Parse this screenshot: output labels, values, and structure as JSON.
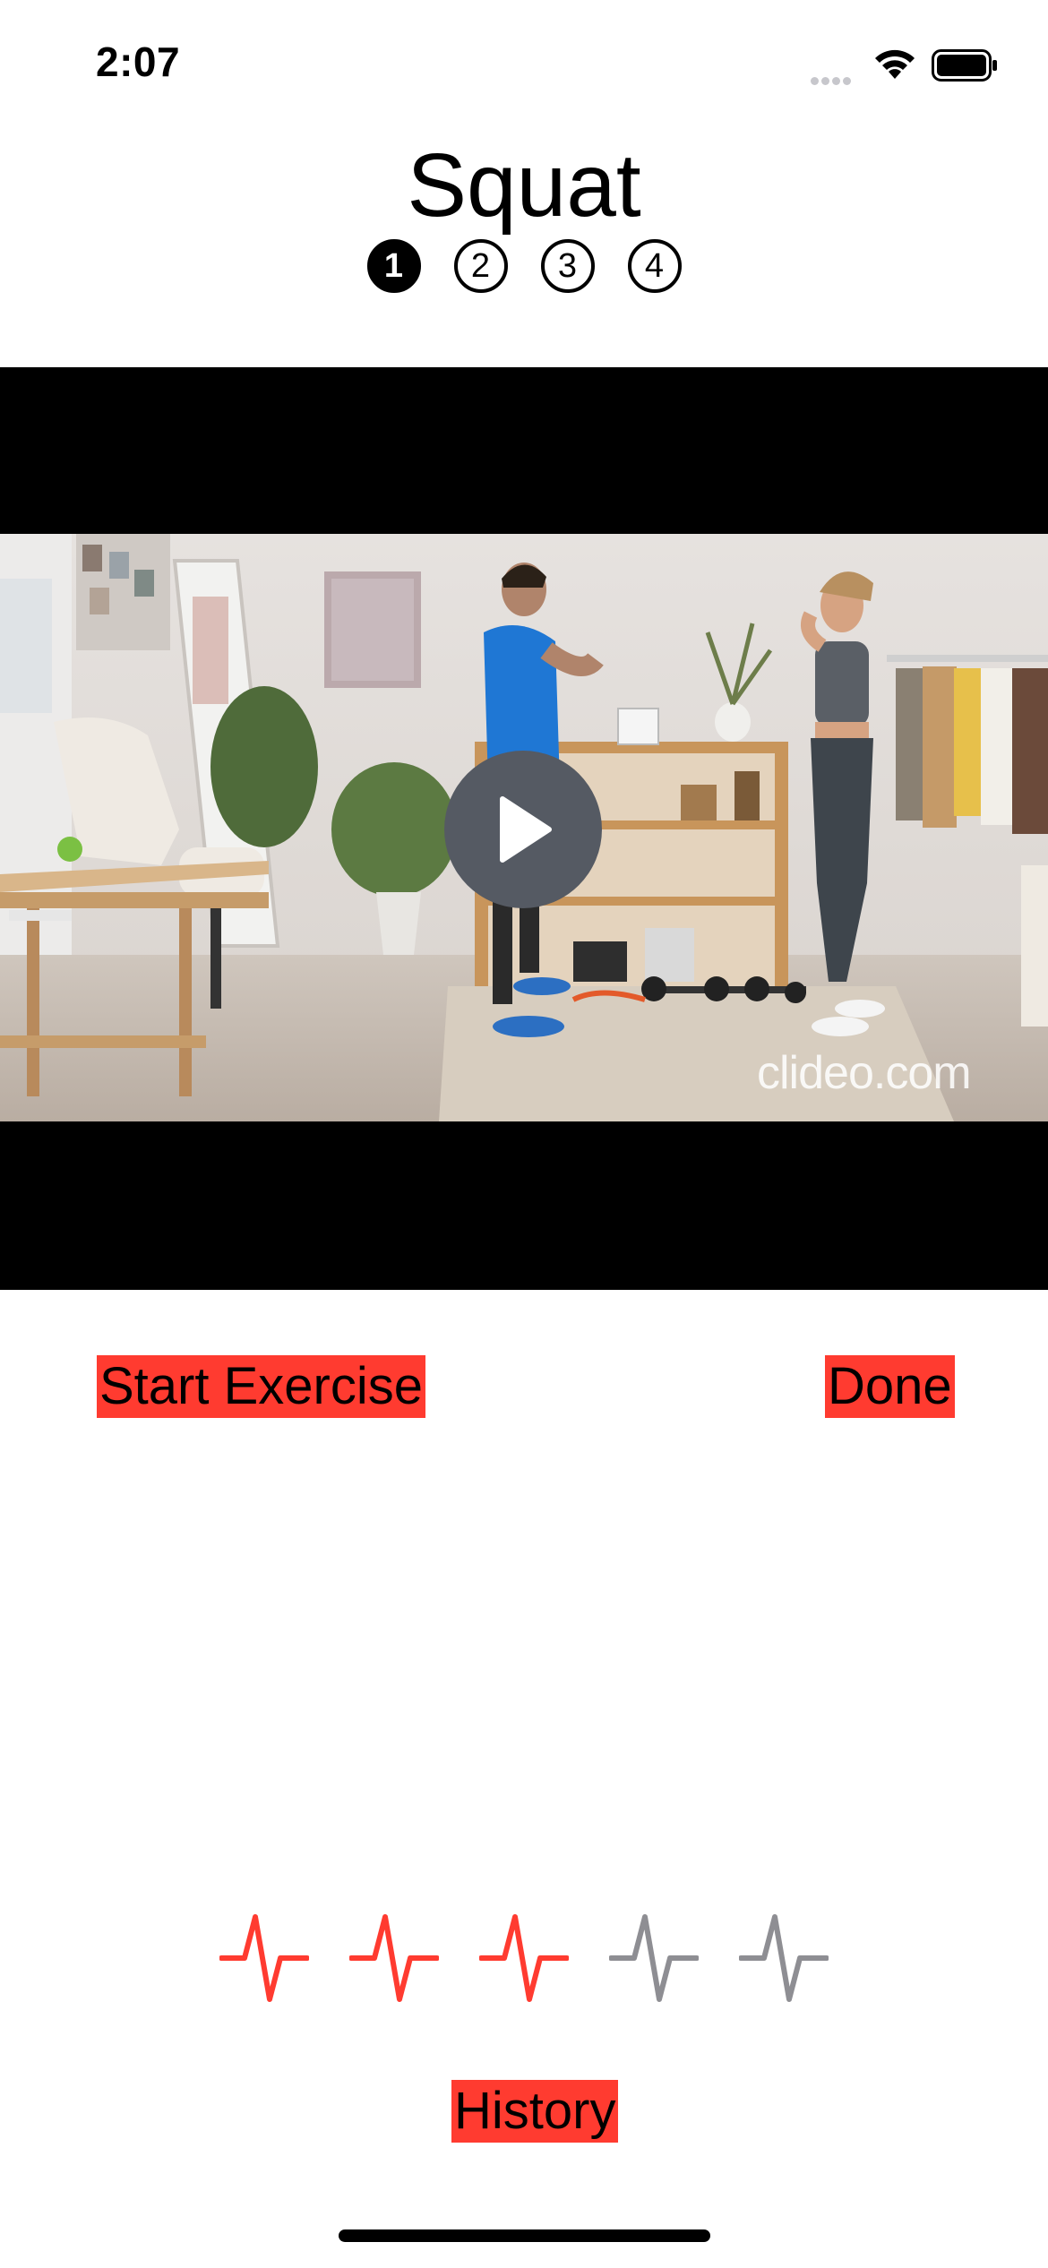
{
  "status_bar": {
    "time": "2:07"
  },
  "exercise": {
    "title": "Squat",
    "steps": [
      {
        "label": "1",
        "active": true
      },
      {
        "label": "2",
        "active": false
      },
      {
        "label": "3",
        "active": false
      },
      {
        "label": "4",
        "active": false
      }
    ]
  },
  "video": {
    "watermark": "clideo.com"
  },
  "actions": {
    "start_label": "Start Exercise",
    "done_label": "Done",
    "history_label": "History"
  },
  "heart_rating": {
    "filled": 3,
    "total": 5
  },
  "colors": {
    "accent": "#ff3b30",
    "pulse_active": "#ff3b30",
    "pulse_inactive": "#8e8e93",
    "video_background": "#000000"
  }
}
